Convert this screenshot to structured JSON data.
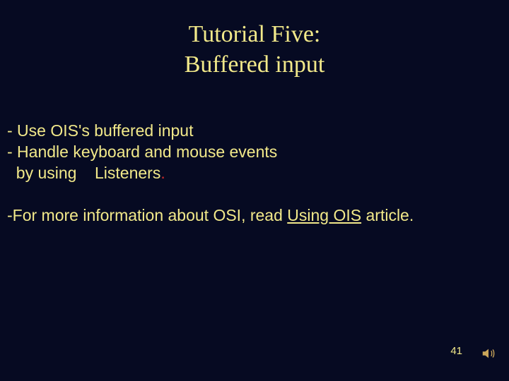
{
  "title": {
    "line1": "Tutorial Five:",
    "line2": "Buffered input"
  },
  "body": {
    "line1": "- Use OIS's buffered input",
    "line2": "- Handle keyboard and mouse events",
    "line3_pre": "  by using    Listeners",
    "line3_period": ".",
    "info_pre": "-For more information about OSI, read ",
    "info_link": "Using OIS",
    "info_post": " article."
  },
  "page_number": "41",
  "icon": "sound-icon"
}
